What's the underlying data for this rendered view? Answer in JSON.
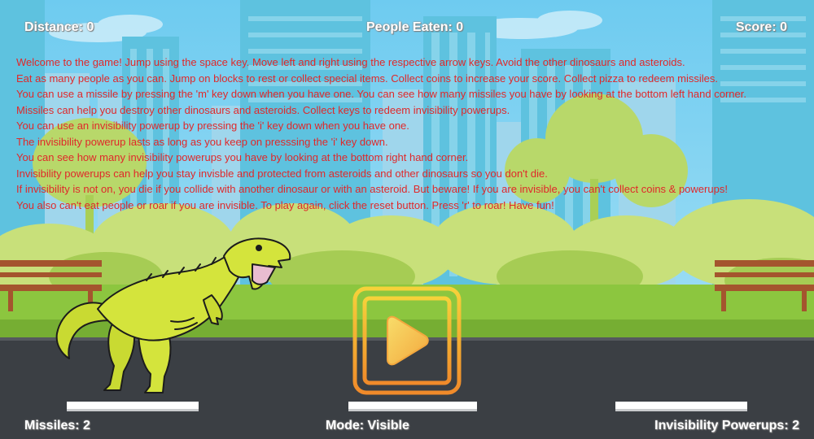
{
  "hud": {
    "distance": "Distance: 0",
    "people_eaten": "People Eaten: 0",
    "score": "Score: 0",
    "missiles": "Missiles: 2",
    "mode": "Mode: Visible",
    "invisibility_powerups": "Invisibility Powerups: 2"
  },
  "instructions": [
    "Welcome to the game! Jump using the space key. Move left and right using the respective arrow keys. Avoid the other dinosaurs and asteroids.",
    "Eat as many people as you can. Jump on blocks to rest or collect special items. Collect coins to increase your score. Collect pizza to redeem missiles.",
    "You can use a missile by pressing the 'm' key down when you have one. You can see how many missiles you have by looking at the bottom left hand corner.",
    "Missiles can help you destroy other dinosaurs and asteroids. Collect keys to redeem invisibility powerups.",
    "You can use an invisibility powerup by pressing the 'i' key down when you have one.",
    "The invisibility powerup lasts as long as you keep on presssing the 'i' key down.",
    "You can see how many invisibility powerups you have by looking at the bottom right hand corner.",
    "Invisibility powerups can help you stay invisble and protected from asteroids and other dinosaurs so you don't die.",
    "If invisibility is not on, you die if you collide with another dinosaur or with an asteroid. But beware! If you are invisible, you can't collect coins & powerups!",
    "You also can't eat people or roar if you are invisible. To play again, click the reset button. Press 'r' to roar! Have fun!"
  ],
  "play_button": {
    "icon": "play-icon"
  },
  "colors": {
    "sky": "#7fd0ef",
    "instruction_text": "#e0282a",
    "hud_text": "#ffffff",
    "play_button": "#f0a030",
    "dinosaur": "#d4e43c",
    "road": "#3b3f44",
    "grass": "#8cc63f"
  }
}
